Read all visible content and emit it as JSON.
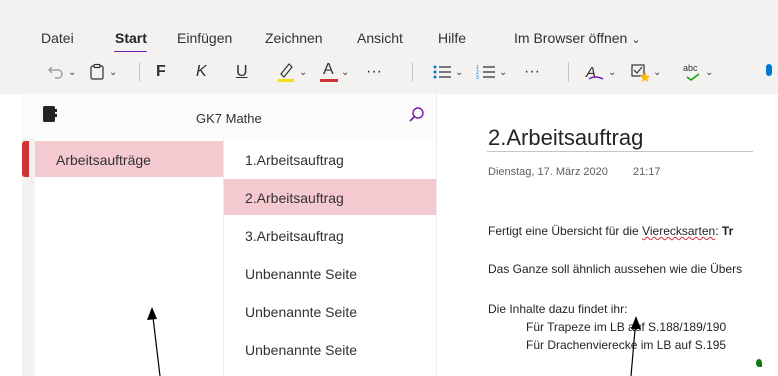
{
  "menu": {
    "tabs": [
      "Datei",
      "Start",
      "Einfügen",
      "Zeichnen",
      "Ansicht",
      "Hilfe",
      "Im Browser öffnen"
    ],
    "active": "Start"
  },
  "toolbar": {
    "bold": "F",
    "italic": "K",
    "underline": "U",
    "font_color": "A",
    "more": "···",
    "spell": "abc",
    "highlight_color": "#f3e01c",
    "font_color_bar": "#d13438",
    "icons": [
      "undo-icon",
      "clipboard-icon",
      "bold-icon",
      "italic-icon",
      "underline-icon",
      "highlighter-icon",
      "font-color-icon",
      "more-icon",
      "bullets-icon",
      "numbering-icon",
      "more-icon",
      "styles-icon",
      "tag-icon",
      "spelling-icon",
      "dictate-icon"
    ]
  },
  "notebook": {
    "name": "GK7 Mathe"
  },
  "sections": [
    {
      "label": "Arbeitsaufträge",
      "color": "#d13438"
    }
  ],
  "pages": [
    {
      "label": "1.Arbeitsauftrag"
    },
    {
      "label": "2.Arbeitsauftrag",
      "selected": true
    },
    {
      "label": "3.Arbeitsauftrag"
    },
    {
      "label": "Unbenannte Seite"
    },
    {
      "label": "Unbenannte Seite"
    },
    {
      "label": "Unbenannte Seite"
    }
  ],
  "page": {
    "title": "2.Arbeitsauftrag",
    "date": "Dienstag, 17. März 2020",
    "time": "21:17",
    "lines": {
      "l1_pre": "Fertigt eine Übersicht für die ",
      "l1_spell": "Vierecksarten",
      "l1_post": ": ",
      "l1_bold": "Tr",
      "l2": "Das Ganze soll ähnlich aussehen wie die Übers",
      "l3": "Die Inhalte dazu findet ihr:",
      "l4": "Für Trapeze im LB auf S.188/189/190",
      "l5": "Für Drachenvierecke im LB auf S.195"
    }
  },
  "colors": {
    "accent": "#7719aa",
    "selection": "#f4c9cf",
    "section_red": "#d13438",
    "chrome": "#f3f2f1"
  }
}
